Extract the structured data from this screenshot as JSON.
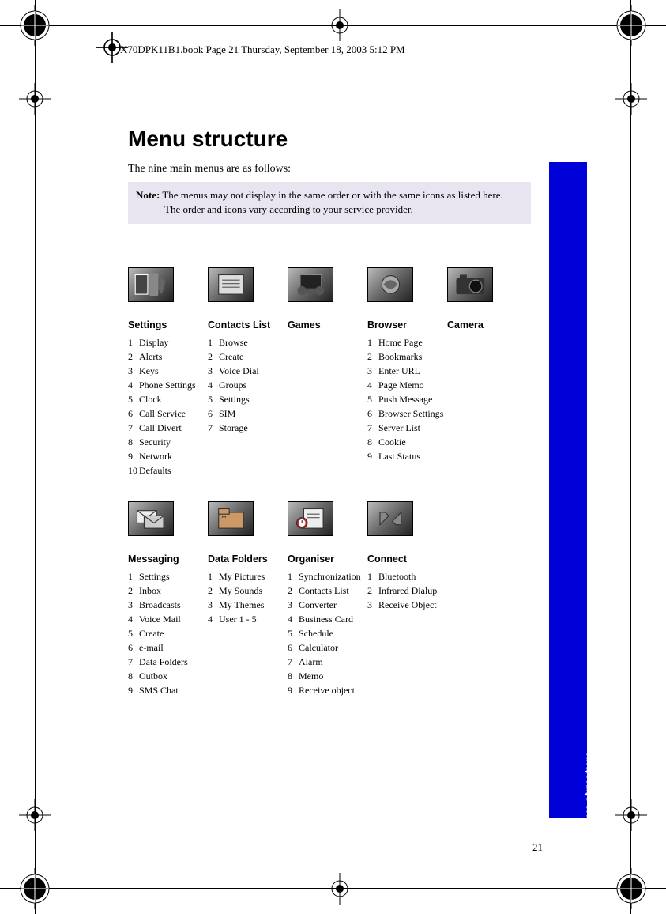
{
  "header": "X70DPK11B1.book  Page 21  Thursday, September 18, 2003  5:12 PM",
  "title": "Menu structure",
  "intro": "The nine main menus are as follows:",
  "note_label": "Note:",
  "note_line1": " The menus may not display in the same order or with the same icons as listed here.",
  "note_line2": "The order and icons vary according to your service provider.",
  "side_tab": "Menu structure",
  "page_number": "21",
  "row1": [
    {
      "icon": "settings-icon",
      "title": "Settings",
      "items": [
        "Display",
        "Alerts",
        "Keys",
        "Phone Settings",
        "Clock",
        "Call Service",
        "Call Divert",
        "Security",
        "Network",
        "Defaults"
      ]
    },
    {
      "icon": "contacts-icon",
      "title": "Contacts List",
      "items": [
        "Browse",
        "Create",
        "Voice Dial",
        "Groups",
        "Settings",
        "SIM",
        "Storage"
      ]
    },
    {
      "icon": "games-icon",
      "title": "Games",
      "items": []
    },
    {
      "icon": "browser-icon",
      "title": "Browser",
      "items": [
        "Home Page",
        "Bookmarks",
        "Enter URL",
        "Page Memo",
        "Push Message",
        "Browser Settings",
        "Server List",
        "Cookie",
        "Last Status"
      ]
    },
    {
      "icon": "camera-icon",
      "title": "Camera",
      "items": []
    }
  ],
  "row2": [
    {
      "icon": "messaging-icon",
      "title": "Messaging",
      "items": [
        "Settings",
        "Inbox",
        "Broadcasts",
        "Voice Mail",
        "Create",
        "e-mail",
        "Data Folders",
        "Outbox",
        "SMS Chat"
      ]
    },
    {
      "icon": "folders-icon",
      "title": "Data Folders",
      "items": [
        "My Pictures",
        "My Sounds",
        "My Themes",
        "User 1 - 5"
      ]
    },
    {
      "icon": "organiser-icon",
      "title": "Organiser",
      "items": [
        "Synchronization",
        "Contacts List",
        "Converter",
        "Business Card",
        "Schedule",
        "Calculator",
        "Alarm",
        "Memo",
        "Receive object"
      ]
    },
    {
      "icon": "connect-icon",
      "title": "Connect",
      "items": [
        "Bluetooth",
        "Infrared Dialup",
        "Receive Object"
      ]
    }
  ]
}
